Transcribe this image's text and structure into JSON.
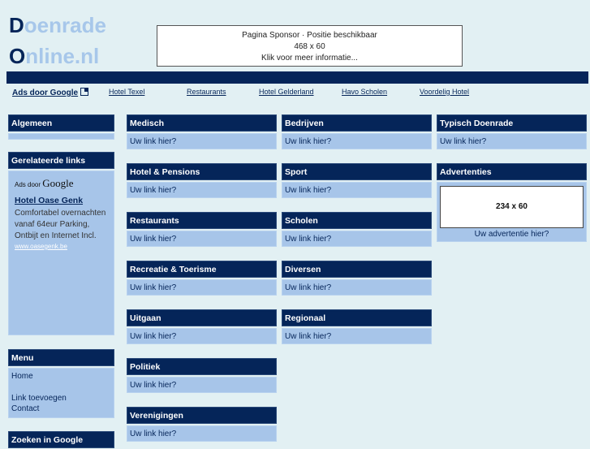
{
  "logo": {
    "line1_cap": "D",
    "line1_rest": "oenrade",
    "line2_cap": "O",
    "line2_rest": "nline.nl"
  },
  "sponsor": {
    "line1": "Pagina Sponsor · Positie beschikbaar",
    "line2": "468 x 60",
    "line3": "Klik voor meer informatie..."
  },
  "linkbar": {
    "ads_label": "Ads door Google",
    "links": [
      "Hotel Texel",
      "Restaurants",
      "Hotel Gelderland",
      "Havo Scholen",
      "Voordelig Hotel"
    ]
  },
  "sidebar": {
    "algemeen": {
      "title": "Algemeen"
    },
    "related": {
      "title": "Gerelateerde links",
      "ads_prefix": "Ads door",
      "ads_brand": "Google",
      "ad_title": "Hotel Oase Genk",
      "ad_desc": "Comfortabel overnachten vanaf 64eur Parking, Ontbijt en Internet Incl.",
      "ad_url": "www.oasegenk.be"
    },
    "menu": {
      "title": "Menu",
      "items": [
        "Home",
        "Link toevoegen",
        "Contact"
      ]
    },
    "search": {
      "title": "Zoeken in Google"
    }
  },
  "categories": {
    "link_text": "Uw link hier?",
    "col1": [
      "Medisch",
      "Hotel & Pensions",
      "Restaurants",
      "Recreatie & Toerisme",
      "Uitgaan",
      "Politiek",
      "Verenigingen"
    ],
    "col2": [
      "Bedrijven",
      "Sport",
      "Scholen",
      "Diversen",
      "Regionaal"
    ],
    "col3": [
      "Typisch Doenrade"
    ]
  },
  "ads_box": {
    "title": "Advertenties",
    "size": "234 x 60",
    "cta": "Uw advertentie hier?"
  }
}
